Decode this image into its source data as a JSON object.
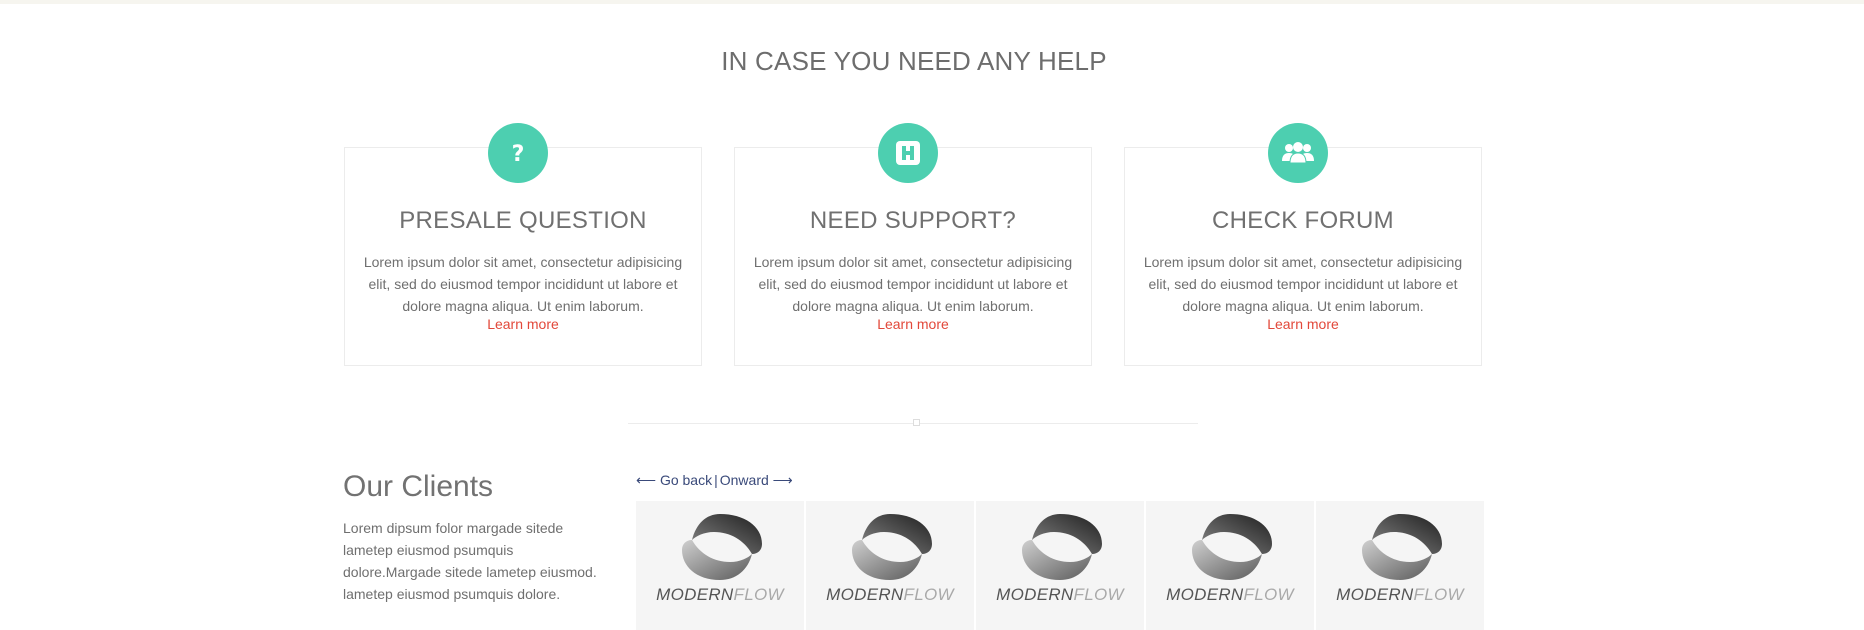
{
  "section": {
    "title": "IN CASE YOU NEED ANY HELP"
  },
  "cards": [
    {
      "icon": "question-icon",
      "title": "PRESALE QUESTION",
      "text": "Lorem ipsum dolor sit amet, consectetur adipisicing elit, sed do eiusmod tempor incididunt ut labore et dolore magna aliqua. Ut enim laborum.",
      "link": "Learn more"
    },
    {
      "icon": "hospital-h-icon",
      "title": "NEED SUPPORT?",
      "text": "Lorem ipsum dolor sit amet, consectetur adipisicing elit, sed do eiusmod tempor incididunt ut labore et dolore magna aliqua. Ut enim laborum.",
      "link": "Learn more"
    },
    {
      "icon": "users-group-icon",
      "title": "CHECK FORUM",
      "text": "Lorem ipsum dolor sit amet, consectetur adipisicing elit, sed do eiusmod tempor incididunt ut labore et dolore magna aliqua. Ut enim laborum.",
      "link": "Learn more"
    }
  ],
  "clients": {
    "title": "Our Clients",
    "text": "Lorem dipsum folor margade sitede lametep eiusmod psumquis dolore.Margade sitede lametep eiusmod. lametep eiusmod psumquis dolore.",
    "nav": {
      "back": "⟵ Go back",
      "separator": "|",
      "forward": "Onward ⟶"
    },
    "logos": [
      {
        "word1": "MODERN",
        "word2": "FLOW",
        "icon": "modernflow-logo-icon"
      },
      {
        "word1": "MODERN",
        "word2": "FLOW",
        "icon": "modernflow-logo-icon"
      },
      {
        "word1": "MODERN",
        "word2": "FLOW",
        "icon": "modernflow-logo-icon"
      },
      {
        "word1": "MODERN",
        "word2": "FLOW",
        "icon": "modernflow-logo-icon"
      },
      {
        "word1": "MODERN",
        "word2": "FLOW",
        "icon": "modernflow-logo-icon"
      }
    ]
  },
  "colors": {
    "accent": "#4dcfb0",
    "link": "#e2483a",
    "nav": "#3a4a7a"
  }
}
